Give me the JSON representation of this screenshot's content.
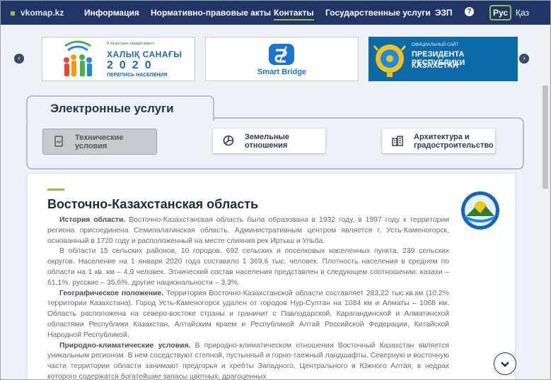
{
  "nav": {
    "logo": "vkomap.kz",
    "items": [
      "Информация",
      "Нормативно-правовые акты",
      "Контакты",
      "Государственные услуги",
      "ЭЗП"
    ],
    "help": "?",
    "lang_ru": "Рус",
    "lang_kz": "Қаз"
  },
  "carousel": {
    "prev": "‹",
    "next": "›",
    "census": {
      "small": "В Казахстане каждый важен!",
      "title": "ХАЛЫҚ САНАҒЫ",
      "year": "2020",
      "sub": "ПЕРЕПИСЬ НАСЕЛЕНИЯ"
    },
    "smartbridge": "Smart Bridge",
    "president": {
      "small": "ОФИЦИАЛЬНЫЙ САЙТ",
      "line1": "ПРЕЗИДЕНТА РЕСПУБЛИКИ",
      "line2": "КАЗАХСТАН"
    }
  },
  "services": {
    "title": "Электронные услуги",
    "buttons": [
      {
        "line1": "Технические",
        "line2": "условия"
      },
      {
        "line1": "Земельные",
        "line2": "отношения"
      },
      {
        "line1": "Архитектура и",
        "line2": "градостроительство"
      }
    ]
  },
  "article": {
    "title": "Восточно-Казахстанская область",
    "p1_bold": "История области.",
    "p1": " Восточно-Казахстанская область была образована в 1932 году, в 1997 году к территории региона присоединена Семипалатинская область. Административным центром является г. Усть-Каменогорск, основанный в 1720 году и расположенный на месте слияния рек Иртыш и Ульба.",
    "p2": "В области 15 сельских районов, 10 городов, 692 сельских и поселковых населенных пункта, 239 сельских округов. Население на 1 января 2020 года составило 1 369,6 тыс. человек. Плотность населения в среднем по области на 1 кв. км – 4,9 человек. Этнический состав населения представлен в следующем соотношении: казахи – 61,1%, русские – 35,6%, другие национальности – 3,3%.",
    "p3_bold": "Географическое положение.",
    "p3": " Территория Восточно-Казахстанской области составляет 283,22 тыс.кв.км (10,2% территории Казахстана). Город Усть-Каменогорск удален от городов Нур-Султан на 1084 км и Алматы – 1068 км. Область расположена на северо-востоке страны и граничит с Павлодарской, Карагандинской и Алматинской областями Республики Казахстан, Алтайским краем и Республикой Алтай Российской Федерации, Китайской Народной Республикой.",
    "p4_bold": "Природно-климатические условия.",
    "p4": " В природно-климатическом отношении Восточный Казахстан является уникальным регионом. В нем соседствуют степной, пустынный и горно-таежный ландшафты. Северную и восточную части территории области занимают предгорья и хребты Западного, Центрального и Южного Алтая, в недрах которого содержатся богатейшие запасы цветных, драгоценных"
  },
  "colors": {
    "nav_bg": "#223567",
    "accent": "#8bc34a",
    "page_bg": "#eef1f5"
  }
}
